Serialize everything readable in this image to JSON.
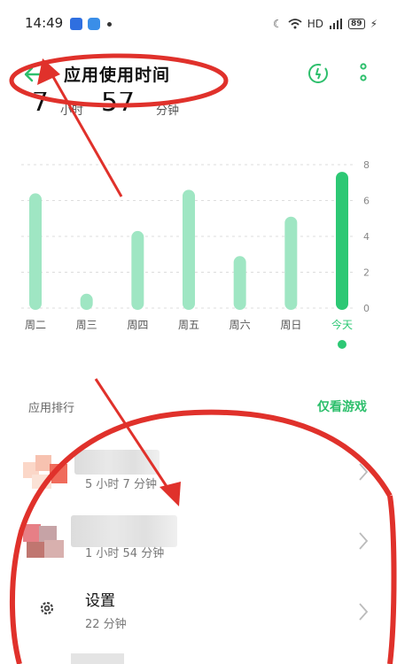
{
  "status_bar": {
    "time": "14:49",
    "network": "HD",
    "battery": "89"
  },
  "header": {
    "title": "应用使用时间"
  },
  "summary": {
    "hours_value": "7",
    "hours_unit": "小时",
    "minutes_value": "57",
    "minutes_unit": "分钟"
  },
  "chart_data": {
    "type": "bar",
    "categories": [
      "周二",
      "周三",
      "周四",
      "周五",
      "周六",
      "周日",
      "今天"
    ],
    "values": [
      6.4,
      0.8,
      4.3,
      6.6,
      2.9,
      5.1,
      7.6
    ],
    "ylim": [
      0,
      8
    ],
    "yticks": [
      "0",
      "2",
      "4",
      "6",
      "8"
    ],
    "grid": true,
    "selected_index": 6,
    "colors": {
      "bar": "#9fe6c3",
      "selected": "#2dc874",
      "grid": "#dddddd"
    }
  },
  "ranking": {
    "label": "应用排行",
    "filter_label": "仅看游戏"
  },
  "apps": [
    {
      "name": "",
      "duration": "5 小时 7 分钟",
      "blurred": true
    },
    {
      "name": "",
      "duration": "1 小时 54 分钟",
      "blurred": true
    },
    {
      "name": "设置",
      "duration": "22 分钟",
      "blurred": false
    }
  ],
  "colors": {
    "accent": "#2dbf6c",
    "annotation": "#e0312b"
  }
}
